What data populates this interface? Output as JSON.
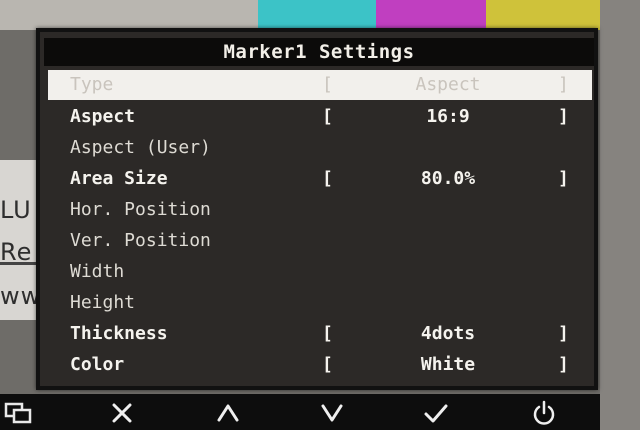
{
  "background": {
    "text_lines": [
      "LU",
      "Re",
      "ww"
    ]
  },
  "osd": {
    "title": "Marker1 Settings",
    "rows": [
      {
        "label": "Type",
        "value": "Aspect",
        "left_bracket": "[",
        "right_bracket": "]"
      },
      {
        "label": "Aspect",
        "value": "16:9",
        "left_bracket": "[",
        "right_bracket": "]"
      },
      {
        "label": "Aspect (User)",
        "value": "",
        "left_bracket": "",
        "right_bracket": ""
      },
      {
        "label": "Area Size",
        "value": "80.0%",
        "left_bracket": "[",
        "right_bracket": "]"
      },
      {
        "label": "Hor. Position",
        "value": "",
        "left_bracket": "",
        "right_bracket": ""
      },
      {
        "label": "Ver. Position",
        "value": "",
        "left_bracket": "",
        "right_bracket": ""
      },
      {
        "label": "Width",
        "value": "",
        "left_bracket": "",
        "right_bracket": ""
      },
      {
        "label": "Height",
        "value": "",
        "left_bracket": "",
        "right_bracket": ""
      },
      {
        "label": "Thickness",
        "value": "4dots",
        "left_bracket": "[",
        "right_bracket": "]"
      },
      {
        "label": "Color",
        "value": "White",
        "left_bracket": "[",
        "right_bracket": "]"
      }
    ]
  },
  "buttons": {
    "input_icon": "input-switch-icon",
    "close_icon": "close-icon",
    "up_icon": "chevron-up-icon",
    "down_icon": "chevron-down-icon",
    "enter_icon": "checkmark-icon",
    "power_icon": "power-icon"
  },
  "colors": {
    "osd_background": "#2c2927",
    "title_bar": "#0c0b0a",
    "selection_highlight": "#f2f0ec",
    "text": "#f5f3ee"
  }
}
